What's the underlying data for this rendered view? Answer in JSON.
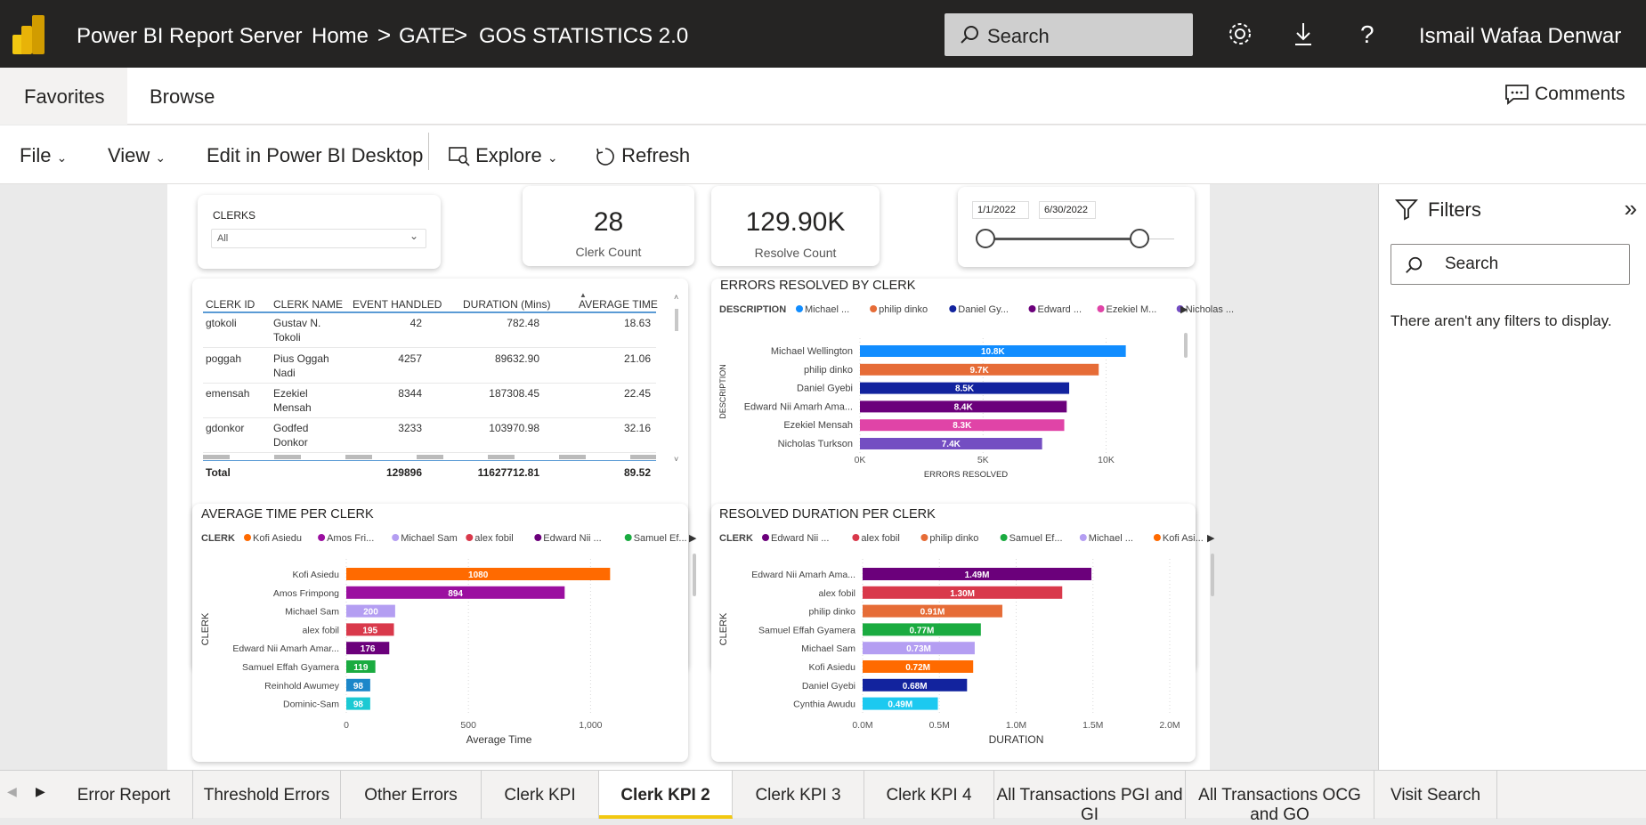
{
  "header": {
    "app_name": "Power BI Report Server",
    "breadcrumb": [
      "Home",
      "GATE",
      "GOS STATISTICS 2.0"
    ],
    "breadcrumb_sep": ">",
    "search_placeholder": "Search",
    "user_name": "Ismail Wafaa Denwar"
  },
  "nav": {
    "favorites": "Favorites",
    "browse": "Browse",
    "comments": "Comments"
  },
  "toolbar": {
    "file": "File",
    "view": "View",
    "edit": "Edit in Power BI Desktop",
    "explore": "Explore",
    "refresh": "Refresh"
  },
  "slicer": {
    "title": "CLERKS",
    "value": "All"
  },
  "kpis": [
    {
      "value": "28",
      "label": "Clerk Count"
    },
    {
      "value": "129.90K",
      "label": "Resolve Count"
    }
  ],
  "date_slicer": {
    "start": "1/1/2022",
    "end": "6/30/2022"
  },
  "table": {
    "headers": [
      "CLERK ID",
      "CLERK NAME",
      "EVENT HANDLED",
      "DURATION (Mins)",
      "AVERAGE TIME"
    ],
    "rows": [
      {
        "id": "gtokoli",
        "name1": "Gustav N.",
        "name2": "Tokoli",
        "events": "42",
        "duration": "782.48",
        "avg": "18.63"
      },
      {
        "id": "poggah",
        "name1": "Pius Oggah",
        "name2": "Nadi",
        "events": "4257",
        "duration": "89632.90",
        "avg": "21.06"
      },
      {
        "id": "emensah",
        "name1": "Ezekiel",
        "name2": "Mensah",
        "events": "8344",
        "duration": "187308.45",
        "avg": "22.45"
      },
      {
        "id": "gdonkor",
        "name1": "Godfed",
        "name2": "Donkor",
        "events": "3233",
        "duration": "103970.98",
        "avg": "32.16"
      }
    ],
    "total": {
      "label": "Total",
      "events": "129896",
      "duration": "11627712.81",
      "avg": "89.52"
    }
  },
  "chart_data": [
    {
      "type": "bar",
      "title": "ERRORS RESOLVED BY CLERK",
      "legend_title": "DESCRIPTION",
      "legend": [
        "Michael ...",
        "philip dinko",
        "Daniel Gy...",
        "Edward ...",
        "Ezekiel M...",
        "Nicholas ..."
      ],
      "categories": [
        "Michael Wellington",
        "philip dinko",
        "Daniel Gyebi",
        "Edward Nii Amarh Ama...",
        "Ezekiel Mensah",
        "Nicholas Turkson"
      ],
      "values": [
        10800,
        9700,
        8500,
        8400,
        8300,
        7400
      ],
      "labels": [
        "10.8K",
        "9.7K",
        "8.5K",
        "8.4K",
        "8.3K",
        "7.4K"
      ],
      "colors": [
        "#118DFF",
        "#E66C37",
        "#12239E",
        "#6B007B",
        "#E044A7",
        "#744EC2"
      ],
      "ticks": [
        "0K",
        "5K",
        "10K"
      ],
      "xlim": [
        0,
        11500
      ],
      "xlabel": "ERRORS RESOLVED",
      "ylabel": "DESCRIPTION"
    },
    {
      "type": "bar",
      "title": "AVERAGE TIME PER CLERK",
      "legend_title": "CLERK",
      "legend": [
        "Kofi Asiedu",
        "Amos Fri...",
        "Michael Sam",
        "alex fobil",
        "Edward Nii ...",
        "Samuel Ef..."
      ],
      "categories": [
        "Kofi Asiedu",
        "Amos Frimpong",
        "Michael Sam",
        "alex fobil",
        "Edward Nii Amarh Amar...",
        "Samuel Effah Gyamera",
        "Reinhold Awumey",
        "Dominic-Sam"
      ],
      "values": [
        1080,
        894,
        200,
        195,
        176,
        119,
        98,
        98
      ],
      "labels": [
        "1080",
        "894",
        "200",
        "195",
        "176",
        "119",
        "98",
        "98"
      ],
      "colors": [
        "#FF6A00",
        "#9B0FA0",
        "#B49EF2",
        "#D9394B",
        "#6B007B",
        "#1AAB40",
        "#1C87C9",
        "#1CC9D3"
      ],
      "ticks": [
        "0",
        "500",
        "1,000"
      ],
      "xlim": [
        0,
        1250
      ],
      "xlabel": "Average Time",
      "ylabel": "CLERK"
    },
    {
      "type": "bar",
      "title": "RESOLVED DURATION PER CLERK",
      "legend_title": "CLERK",
      "legend": [
        "Edward Nii ...",
        "alex fobil",
        "philip dinko",
        "Samuel Ef...",
        "Michael ...",
        "Kofi Asi..."
      ],
      "categories": [
        "Edward Nii Amarh Ama...",
        "alex fobil",
        "philip dinko",
        "Samuel Effah Gyamera",
        "Michael Sam",
        "Kofi Asiedu",
        "Daniel Gyebi",
        "Cynthia Awudu"
      ],
      "values": [
        1.49,
        1.3,
        0.91,
        0.77,
        0.73,
        0.72,
        0.68,
        0.49
      ],
      "labels": [
        "1.49M",
        "1.30M",
        "0.91M",
        "0.77M",
        "0.73M",
        "0.72M",
        "0.68M",
        "0.49M"
      ],
      "colors": [
        "#6B007B",
        "#D9394B",
        "#E66C37",
        "#1AAB40",
        "#B49EF2",
        "#FF6A00",
        "#12239E",
        "#1CC9F0"
      ],
      "ticks": [
        "0.0M",
        "0.5M",
        "1.0M",
        "1.5M",
        "2.0M"
      ],
      "xlim": [
        0,
        2.0
      ],
      "xlabel": "DURATION",
      "ylabel": "CLERK"
    }
  ],
  "filters": {
    "title": "Filters",
    "search_placeholder": "Search",
    "empty_text": "There aren't any filters to display."
  },
  "tabs": [
    "Error Report",
    "Threshold Errors",
    "Other Errors",
    "Clerk KPI",
    "Clerk KPI 2",
    "Clerk KPI 3",
    "Clerk KPI 4",
    "All Transactions PGI and GI",
    "All Transactions OCG and GO",
    "Visit Search"
  ],
  "active_tab": "Clerk KPI 2"
}
